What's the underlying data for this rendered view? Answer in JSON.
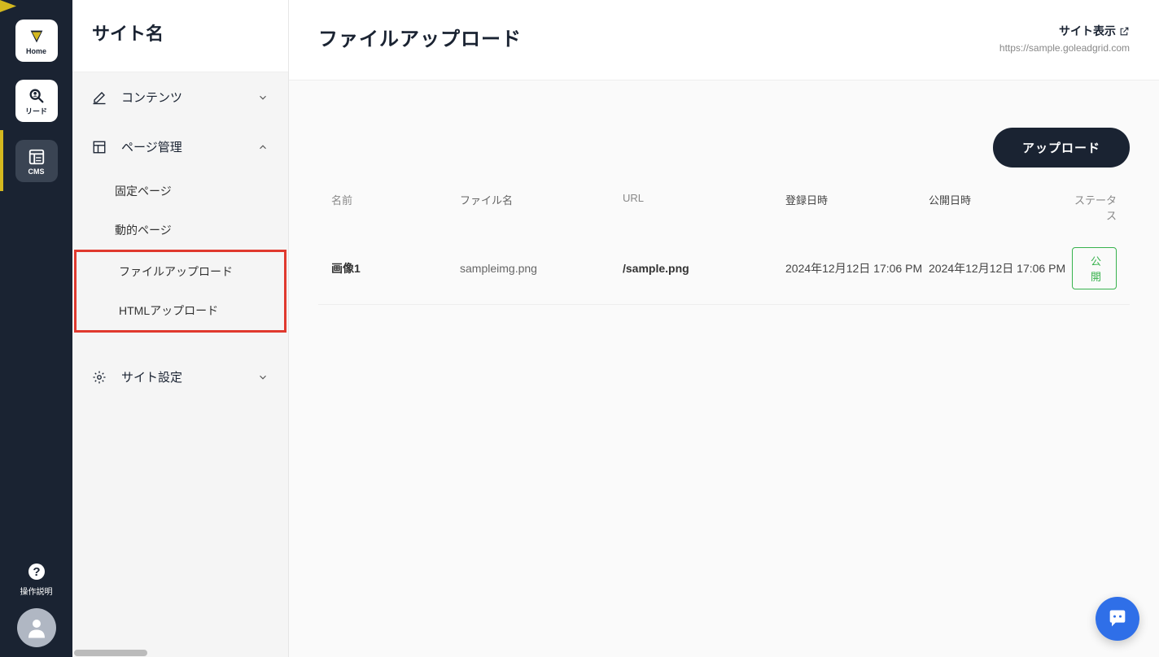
{
  "rail": {
    "home_label": "Home",
    "lead_label": "リード",
    "cms_label": "CMS",
    "help_label": "操作説明"
  },
  "sidebar": {
    "site_name": "サイト名",
    "sections": {
      "contents": {
        "label": "コンテンツ"
      },
      "page_mgmt": {
        "label": "ページ管理",
        "items": {
          "fixed": "固定ページ",
          "dynamic": "動的ページ",
          "file_upload": "ファイルアップロード",
          "html_upload": "HTMLアップロード"
        }
      },
      "site_settings": {
        "label": "サイト設定"
      }
    }
  },
  "header": {
    "title": "ファイルアップロード",
    "site_view": "サイト表示",
    "site_url": "https://sample.goleadgrid.com"
  },
  "toolbar": {
    "upload_label": "アップロード"
  },
  "table": {
    "columns": {
      "name": "名前",
      "filename": "ファイル名",
      "url": "URL",
      "created": "登録日時",
      "published": "公開日時",
      "status": "ステータス"
    },
    "rows": [
      {
        "name": "画像1",
        "filename": "sampleimg.png",
        "url": "/sample.png",
        "created": "2024年12月12日 17:06 PM",
        "published": "2024年12月12日 17:06 PM",
        "status": "公開"
      }
    ]
  }
}
